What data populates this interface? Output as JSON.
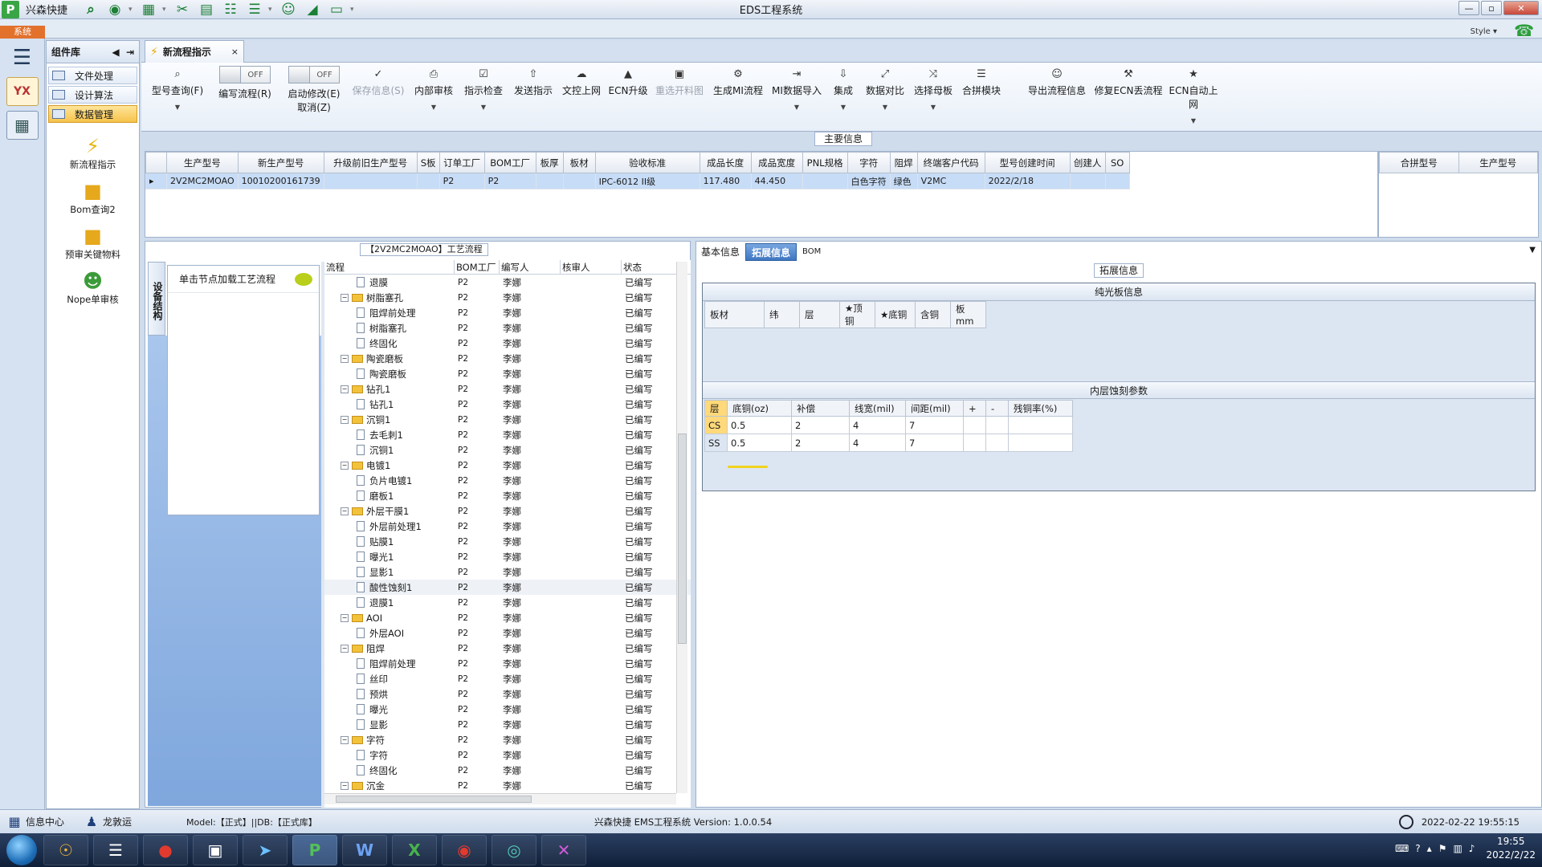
{
  "window": {
    "app_name": "兴森快捷",
    "title": "EDS工程系统",
    "min": "—",
    "max": "▫",
    "close": "✕"
  },
  "menu": {
    "system_tab": "系统",
    "style_label": "Style ▾"
  },
  "complib": {
    "title": "组件库",
    "nav": [
      "文件处理",
      "设计算法",
      "数据管理"
    ],
    "tools": [
      "新流程指示",
      "Bom查询2",
      "预审关键物料",
      "Nope单审核"
    ]
  },
  "doc_tab": {
    "label": "新流程指示",
    "close": "×"
  },
  "ribbon": {
    "model_query": "型号查询(F)",
    "toggle_off": "OFF",
    "write_flow": "编写流程(R)",
    "start_modify": "启动修改(E)",
    "cancel": "取消(Z)",
    "save_info": "保存信息(S)",
    "internal_review": "内部审核",
    "check_instr": "指示检查",
    "send_instr": "发送指示",
    "upload_file": "文控上网",
    "ecn_upgrade": "ECN升级",
    "reselect_drawing": "重选开料图",
    "gen_mi_flow": "生成MI流程",
    "mi_import": "MI数据导入",
    "integrate": "集成",
    "data_compare": "数据对比",
    "select_mother": "选择母板",
    "merge_module": "合拼模块",
    "export_flow": "导出流程信息",
    "fix_ecn": "修复ECN丢流程",
    "ecn_auto_upload": "ECN自动上网"
  },
  "main_info": {
    "label": "主要信息",
    "columns": [
      "生产型号",
      "新生产型号",
      "升级前旧生产型号",
      "S板",
      "订单工厂",
      "BOM工厂",
      "板厚",
      "板材",
      "验收标准",
      "成品长度",
      "成品宽度",
      "PNL规格",
      "字符",
      "阻焊",
      "终端客户代码",
      "型号创建时间",
      "创建人",
      "SO"
    ],
    "row": [
      "2V2MC2MOAO",
      "10010200161739",
      "",
      "",
      "P2",
      "P2",
      "",
      "",
      "IPC-6012 II级",
      "117.480",
      "44.450",
      "",
      "白色字符",
      "绿色",
      "V2MC",
      "2022/2/18",
      "",
      ""
    ],
    "right_columns": [
      "合拼型号",
      "生产型号"
    ]
  },
  "process": {
    "title": "【2V2MC2MOAO】工艺流程",
    "side_tab": "设备结构",
    "hint": "单击节点加载工艺流程",
    "columns": [
      "流程",
      "BOM工厂",
      "编写人",
      "核审人",
      "状态"
    ],
    "rows": [
      {
        "level": 2,
        "type": "file",
        "name": "退膜",
        "factory": "P2",
        "editor": "李娜",
        "status": "已编写"
      },
      {
        "level": 1,
        "type": "folder",
        "name": "树脂塞孔",
        "factory": "P2",
        "editor": "李娜",
        "status": "已编写"
      },
      {
        "level": 2,
        "type": "file",
        "name": "阻焊前处理",
        "factory": "P2",
        "editor": "李娜",
        "status": "已编写"
      },
      {
        "level": 2,
        "type": "file",
        "name": "树脂塞孔",
        "factory": "P2",
        "editor": "李娜",
        "status": "已编写"
      },
      {
        "level": 2,
        "type": "file",
        "name": "终固化",
        "factory": "P2",
        "editor": "李娜",
        "status": "已编写"
      },
      {
        "level": 1,
        "type": "folder",
        "name": "陶瓷磨板",
        "factory": "P2",
        "editor": "李娜",
        "status": "已编写"
      },
      {
        "level": 2,
        "type": "file",
        "name": "陶瓷磨板",
        "factory": "P2",
        "editor": "李娜",
        "status": "已编写"
      },
      {
        "level": 1,
        "type": "folder",
        "name": "钻孔1",
        "factory": "P2",
        "editor": "李娜",
        "status": "已编写"
      },
      {
        "level": 2,
        "type": "file",
        "name": "钻孔1",
        "factory": "P2",
        "editor": "李娜",
        "status": "已编写"
      },
      {
        "level": 1,
        "type": "folder",
        "name": "沉铜1",
        "factory": "P2",
        "editor": "李娜",
        "status": "已编写"
      },
      {
        "level": 2,
        "type": "file",
        "name": "去毛刺1",
        "factory": "P2",
        "editor": "李娜",
        "status": "已编写"
      },
      {
        "level": 2,
        "type": "file",
        "name": "沉铜1",
        "factory": "P2",
        "editor": "李娜",
        "status": "已编写"
      },
      {
        "level": 1,
        "type": "folder",
        "name": "电镀1",
        "factory": "P2",
        "editor": "李娜",
        "status": "已编写"
      },
      {
        "level": 2,
        "type": "file",
        "name": "负片电镀1",
        "factory": "P2",
        "editor": "李娜",
        "status": "已编写"
      },
      {
        "level": 2,
        "type": "file",
        "name": "磨板1",
        "factory": "P2",
        "editor": "李娜",
        "status": "已编写"
      },
      {
        "level": 1,
        "type": "folder",
        "name": "外层干膜1",
        "factory": "P2",
        "editor": "李娜",
        "status": "已编写"
      },
      {
        "level": 2,
        "type": "file",
        "name": "外层前处理1",
        "factory": "P2",
        "editor": "李娜",
        "status": "已编写"
      },
      {
        "level": 2,
        "type": "file",
        "name": "贴膜1",
        "factory": "P2",
        "editor": "李娜",
        "status": "已编写"
      },
      {
        "level": 2,
        "type": "file",
        "name": "曝光1",
        "factory": "P2",
        "editor": "李娜",
        "status": "已编写"
      },
      {
        "level": 2,
        "type": "file",
        "name": "显影1",
        "factory": "P2",
        "editor": "李娜",
        "status": "已编写"
      },
      {
        "level": 2,
        "type": "file",
        "name": "酸性蚀刻1",
        "factory": "P2",
        "editor": "李娜",
        "status": "已编写",
        "highlight": true
      },
      {
        "level": 2,
        "type": "file",
        "name": "退膜1",
        "factory": "P2",
        "editor": "李娜",
        "status": "已编写"
      },
      {
        "level": 1,
        "type": "folder",
        "name": "AOI",
        "factory": "P2",
        "editor": "李娜",
        "status": "已编写"
      },
      {
        "level": 2,
        "type": "file",
        "name": "外层AOI",
        "factory": "P2",
        "editor": "李娜",
        "status": "已编写"
      },
      {
        "level": 1,
        "type": "folder",
        "name": "阻焊",
        "factory": "P2",
        "editor": "李娜",
        "status": "已编写"
      },
      {
        "level": 2,
        "type": "file",
        "name": "阻焊前处理",
        "factory": "P2",
        "editor": "李娜",
        "status": "已编写"
      },
      {
        "level": 2,
        "type": "file",
        "name": "丝印",
        "factory": "P2",
        "editor": "李娜",
        "status": "已编写"
      },
      {
        "level": 2,
        "type": "file",
        "name": "预烘",
        "factory": "P2",
        "editor": "李娜",
        "status": "已编写"
      },
      {
        "level": 2,
        "type": "file",
        "name": "曝光",
        "factory": "P2",
        "editor": "李娜",
        "status": "已编写"
      },
      {
        "level": 2,
        "type": "file",
        "name": "显影",
        "factory": "P2",
        "editor": "李娜",
        "status": "已编写"
      },
      {
        "level": 1,
        "type": "folder",
        "name": "字符",
        "factory": "P2",
        "editor": "李娜",
        "status": "已编写"
      },
      {
        "level": 2,
        "type": "file",
        "name": "字符",
        "factory": "P2",
        "editor": "李娜",
        "status": "已编写"
      },
      {
        "level": 2,
        "type": "file",
        "name": "终固化",
        "factory": "P2",
        "editor": "李娜",
        "status": "已编写"
      },
      {
        "level": 1,
        "type": "folder",
        "name": "沉金",
        "factory": "P2",
        "editor": "李娜",
        "status": "已编写"
      }
    ]
  },
  "right_tabs": [
    "基本信息",
    "拓展信息",
    "BOM"
  ],
  "ext_info": {
    "label": "拓展信息",
    "plate_title": "纯光板信息",
    "plate_columns": [
      "板材",
      "纬",
      "层",
      "★顶铜",
      "★底铜",
      "含铜",
      "板mm"
    ],
    "etch_title": "内层蚀刻参数",
    "etch_columns": [
      "层",
      "底铜(oz)",
      "补偿",
      "线宽(mil)",
      "间距(mil)",
      "+",
      "-",
      "残铜率(%)"
    ],
    "etch_rows": [
      [
        "CS",
        "0.5",
        "2",
        "4",
        "7",
        "",
        "",
        ""
      ],
      [
        "SS",
        "0.5",
        "2",
        "4",
        "7",
        "",
        "",
        ""
      ]
    ]
  },
  "status": {
    "info_center": "信息中心",
    "user": "龙敦运",
    "model": "Model:【正式】||DB:【正式库】",
    "center": "兴森快捷 EMS工程系统 Version: 1.0.0.54",
    "datetime": "2022-02-22 19:55:15"
  },
  "taskbar": {
    "time": "19:55",
    "date": "2022/2/22"
  }
}
